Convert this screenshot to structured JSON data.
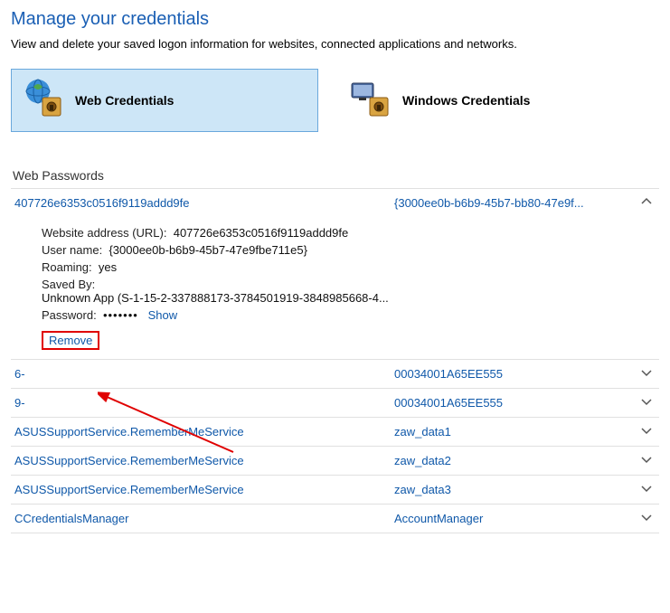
{
  "header": {
    "title": "Manage your credentials",
    "subtitle": "View and delete your saved logon information for websites, connected applications and networks."
  },
  "tabs": {
    "web": "Web Credentials",
    "windows": "Windows Credentials"
  },
  "section": {
    "web_passwords": "Web Passwords"
  },
  "expanded": {
    "left": "407726e6353c0516f9119addd9fe",
    "right": "{3000ee0b-b6b9-45b7-bb80-47e9f...",
    "url_label": "Website address (URL):",
    "url_value": "407726e6353c0516f9119addd9fe",
    "user_label": "User name:",
    "user_value": "{3000ee0b-b6b9-45b7-47e9fbe711e5}",
    "roaming_label": "Roaming:",
    "roaming_value": "yes",
    "savedby_label": "Saved By:",
    "savedby_value": "Unknown App (S-1-15-2-337888173-3784501919-3848985668-4...",
    "password_label": "Password:",
    "password_dots": "•••••••",
    "show": "Show",
    "remove": "Remove"
  },
  "rows": [
    {
      "left": "6-",
      "right": "00034001A65EE555"
    },
    {
      "left": "9-",
      "right": "00034001A65EE555"
    },
    {
      "left": "ASUSSupportService.RememberMeService",
      "right": "zaw_data1"
    },
    {
      "left": "ASUSSupportService.RememberMeService",
      "right": "zaw_data2"
    },
    {
      "left": "ASUSSupportService.RememberMeService",
      "right": "zaw_data3"
    },
    {
      "left": "CCredentialsManager",
      "right": "AccountManager"
    }
  ]
}
